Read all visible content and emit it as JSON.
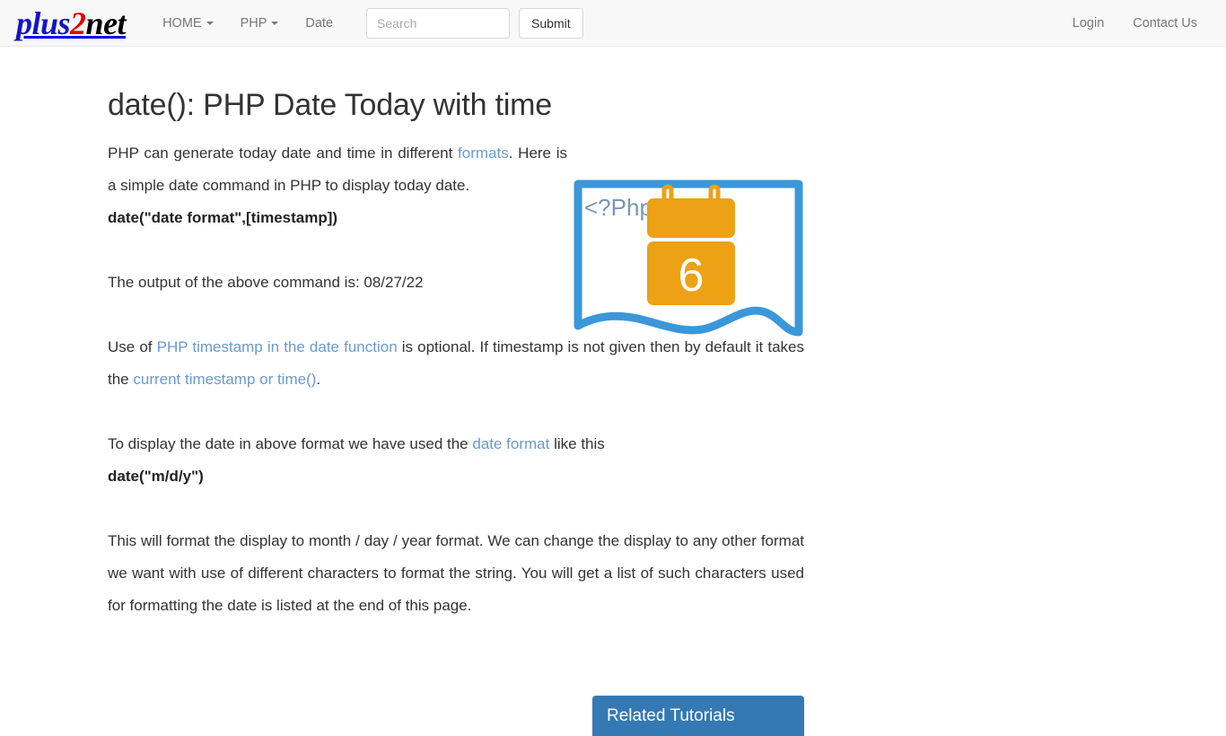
{
  "site": {
    "brand": {
      "part1": "plus",
      "part2": "2",
      "part3": "net"
    }
  },
  "nav": {
    "items": [
      {
        "label": "HOME",
        "has_caret": true
      },
      {
        "label": "PHP",
        "has_caret": true
      },
      {
        "label": "Date",
        "has_caret": false
      }
    ],
    "search": {
      "placeholder": "Search",
      "value": "",
      "submit_label": "Submit"
    },
    "right_items": [
      {
        "label": "Login"
      },
      {
        "label": "Contact Us"
      }
    ]
  },
  "article": {
    "title": "date(): PHP Date Today with time",
    "intro": {
      "text_before_link": "PHP can generate today date and time in different ",
      "link_text": "formats",
      "text_after_link": ". Here is a simple date command in PHP to display today date."
    },
    "signature_code": "date(\"date format\",[timestamp])",
    "output_line": "The output of the above command is: 08/27/22",
    "output_value": "08/27/22",
    "timestamp_para": {
      "part1": "Use of ",
      "link1": "PHP timestamp in the date function",
      "part2": " is optional. If timestamp is not given then by default it takes the ",
      "link2": "current timestamp or time()",
      "part3": "."
    },
    "format_para": {
      "part1": "To display the date in above format we have used the ",
      "link1": "date format",
      "part2": " like this"
    },
    "format_code": "date(\"m/d/y\")",
    "closing_para": "This will format the display to month / day / year format. We can change the display to any other format we want with use of different characters to format the string. You will get a list of such characters used for formatting the date is listed at the end of this page."
  },
  "illustration": {
    "php_tag_text": "<?Php",
    "calendar_day": "6",
    "banner_color": "#3b97d9",
    "calendar_color": "#eda114",
    "php_tag_color": "#7a96b4"
  },
  "related": {
    "title": "Related Tutorials",
    "accent_color": "#3479b4"
  }
}
